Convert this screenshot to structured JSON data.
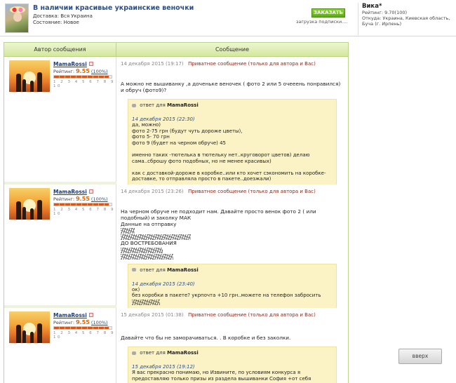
{
  "lot": {
    "title": "В наличии красивые украинские веночки",
    "delivery": "Доставка: Вся Украина",
    "condition": "Состояние: Новое",
    "order_label": "ЗАКАЗАТЬ",
    "loading_text": "загрузка подписки...."
  },
  "seller": {
    "name": "Вика*",
    "rating": "Рейтинг: 9.70(100)",
    "from": "Откуда: Украина, Киевская область,",
    "city": "Буча (г. Ирпень)"
  },
  "table": {
    "col_author": "Автор сообщения",
    "col_message": "Сообщение"
  },
  "rows": [
    {
      "author": "MamaRossi",
      "rating_label": "Рейтинг:",
      "rating": "9.55",
      "percent": "(100%)",
      "scale": "1 2 3 4 5 6 7 8 9 10",
      "date": "14 декабря 2015 (19:17)",
      "private": "Приватное сообщение (только для автора и Вас)",
      "text": "А можно не вышиванку ,а доченьке веночек ( фото 2 или 5 очееень понравился) и обруч (фото9)?",
      "reply_prefix": "ответ для",
      "reply_to": "MamaRossi",
      "reply_date": "14 декабря 2015 (22:30)",
      "reply_text": "да, можно)\nфото 2-75 грн (будут чуть дороже цветы),\nфото 5- 70 грн\nфото 9 (будет на черном обруче) 45\n\nименно таких -тютелька в тютельку нет..круговорот цветов) делаю сама..сброшу фото подобных, но не менее красивых)\n\nкак с доставкой-дороже в коробке..или кто хочет сэкономить на коробке-доставке, то отправляла просто в пакете..доезжали)"
    },
    {
      "author": "MamaRossi",
      "rating_label": "Рейтинг:",
      "rating": "9.55",
      "percent": "(100%)",
      "scale": "1 2 3 4 5 6 7 8 9 10",
      "date": "14 декабря 2015 (23:26)",
      "private": "Приватное сообщение (только для автора и Вас)",
      "text": "На черном обруче не подходит нам. Давайте просто венок фото 2 ( или подобный) и заколку МАК\nДанные на отправку",
      "text_after": "ДО ВОСТРЕБОВАНИЯ",
      "reply_prefix": "ответ для",
      "reply_to": "MamaRossi",
      "reply_date": "14 декабря 2015 (23:40)",
      "reply_text": "ок)\nбез коробки в пакете? укрпочта +10 грн..можете на телефон забросить"
    },
    {
      "author": "MamaRossi",
      "rating_label": "Рейтинг:",
      "rating": "9.55",
      "percent": "(100%)",
      "scale": "1 2 3 4 5 6 7 8 9 10",
      "date": "15 декабря 2015 (01:38)",
      "private": "Приватное сообщение (только для автора и Вас)",
      "text": "Давайте что бы не заморачиваться. . В коробке и без заколки.",
      "reply_prefix": "ответ для",
      "reply_to": "MamaRossi",
      "reply_date": "15 декабря 2015 (19:12)",
      "reply_text": "Я вас прекрасно понимаю, но Извините, по условиям конкурса я предоставляю только призы из раздела вышиванки София +от себя"
    }
  ],
  "up_label": "вверх"
}
